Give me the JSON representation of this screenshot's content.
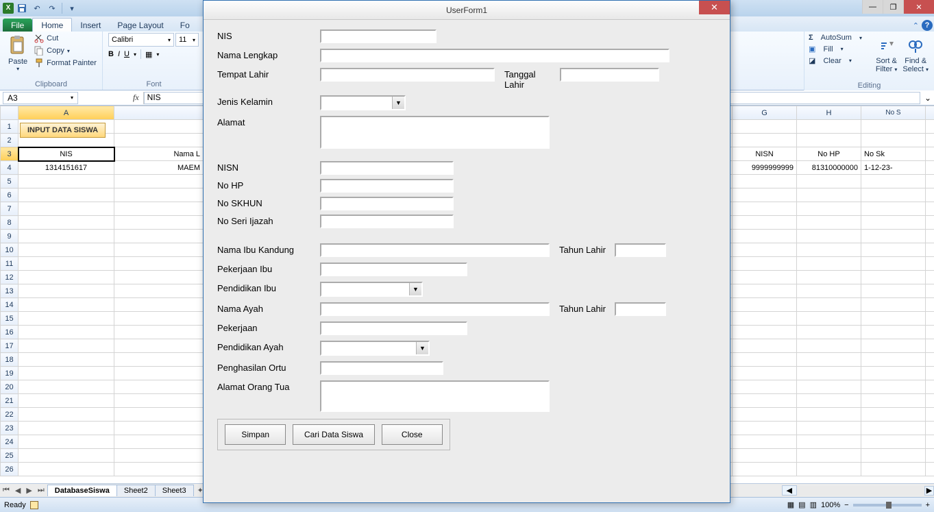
{
  "window": {
    "title_close_x": "✕",
    "minimize": "—",
    "restore": "❐"
  },
  "qat": {
    "save_tip": "Save",
    "undo": "↶",
    "redo": "↷",
    "down": "▾"
  },
  "ribbon": {
    "file": "File",
    "tabs": [
      "Home",
      "Insert",
      "Page Layout",
      "Fo"
    ],
    "clipboard": {
      "paste": "Paste",
      "cut": "Cut",
      "copy": "Copy",
      "formatpainter": "Format Painter",
      "label": "Clipboard"
    },
    "font": {
      "name": "Calibri",
      "size": "11",
      "label": "Font"
    },
    "editing": {
      "autosum": "AutoSum",
      "fill": "Fill",
      "clear": "Clear",
      "sortfilter_l1": "Sort &",
      "sortfilter_l2": "Filter",
      "findselect_l1": "Find &",
      "findselect_l2": "Select",
      "label": "Editing"
    }
  },
  "namebox": "A3",
  "fx": "fx",
  "formula": "NIS",
  "columns_left": [
    "A"
  ],
  "columns_right": [
    "G",
    "H",
    "No S"
  ],
  "rows": [
    "1",
    "2",
    "3",
    "4",
    "5",
    "6",
    "7",
    "8",
    "9",
    "10",
    "11",
    "12",
    "13",
    "14",
    "15",
    "16",
    "17",
    "18",
    "19",
    "20",
    "21",
    "22",
    "23",
    "24",
    "25",
    "26"
  ],
  "grid_left": {
    "input_btn": "INPUT DATA SISWA",
    "a3": "NIS",
    "b3": "Nama L",
    "a4": "1314151617",
    "b4": "MAEM"
  },
  "grid_right": {
    "g3": "NISN",
    "h3": "No HP",
    "i3": "No Sk",
    "g4": "9999999999",
    "h4": "81310000000",
    "i4": "1-12-23-"
  },
  "sheets": {
    "active": "DatabaseSiswa",
    "others": [
      "Sheet2",
      "Sheet3"
    ]
  },
  "status": {
    "ready": "Ready",
    "zoom": "100%",
    "minus": "−",
    "plus": "+"
  },
  "dialog": {
    "title": "UserForm1",
    "close_x": "✕",
    "labels": {
      "nis": "NIS",
      "nama_lengkap": "Nama Lengkap",
      "tempat_lahir": "Tempat Lahir",
      "tanggal_lahir": "Tanggal Lahir",
      "jenis_kelamin": "Jenis Kelamin",
      "alamat": "Alamat",
      "nisn": "NISN",
      "no_hp": "No HP",
      "no_skhun": "No SKHUN",
      "no_seri_ijazah": "No Seri Ijazah",
      "nama_ibu": "Nama Ibu Kandung",
      "tahun_lahir": "Tahun Lahir",
      "pekerjaan_ibu": "Pekerjaan Ibu",
      "pendidikan_ibu": "Pendidikan Ibu",
      "nama_ayah": "Nama Ayah",
      "pekerjaan": "Pekerjaan",
      "pendidikan_ayah": "Pendidikan Ayah",
      "penghasilan_ortu": "Penghasilan Ortu",
      "alamat_ortu": "Alamat Orang Tua"
    },
    "buttons": {
      "simpan": "Simpan",
      "cari": "Cari Data Siswa",
      "close": "Close"
    },
    "combo_caret": "▼"
  }
}
